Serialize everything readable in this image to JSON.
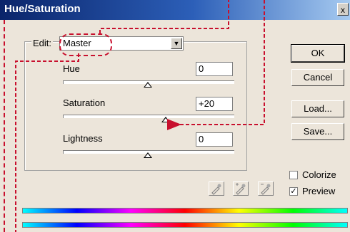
{
  "window": {
    "title": "Hue/Saturation",
    "close_label": "x"
  },
  "edit": {
    "label": "Edit:",
    "selected": "Master"
  },
  "sliders": [
    {
      "label": "Hue",
      "value": "0",
      "level": 0.5
    },
    {
      "label": "Saturation",
      "value": "+20",
      "level": 0.6
    },
    {
      "label": "Lightness",
      "value": "0",
      "level": 0.5
    }
  ],
  "buttons": {
    "ok": "OK",
    "cancel": "Cancel",
    "load": "Load...",
    "save": "Save..."
  },
  "options": {
    "colorize": "Colorize",
    "colorize_checked": false,
    "preview": "Preview",
    "preview_checked": true
  },
  "colors": {
    "annotation": "#c8102e",
    "title_bg": "#0a246a",
    "dialog_bg": "#ece5da"
  },
  "icons": [
    "eyedropper-icon",
    "eyedropper-plus-icon",
    "eyedropper-minus-icon"
  ]
}
